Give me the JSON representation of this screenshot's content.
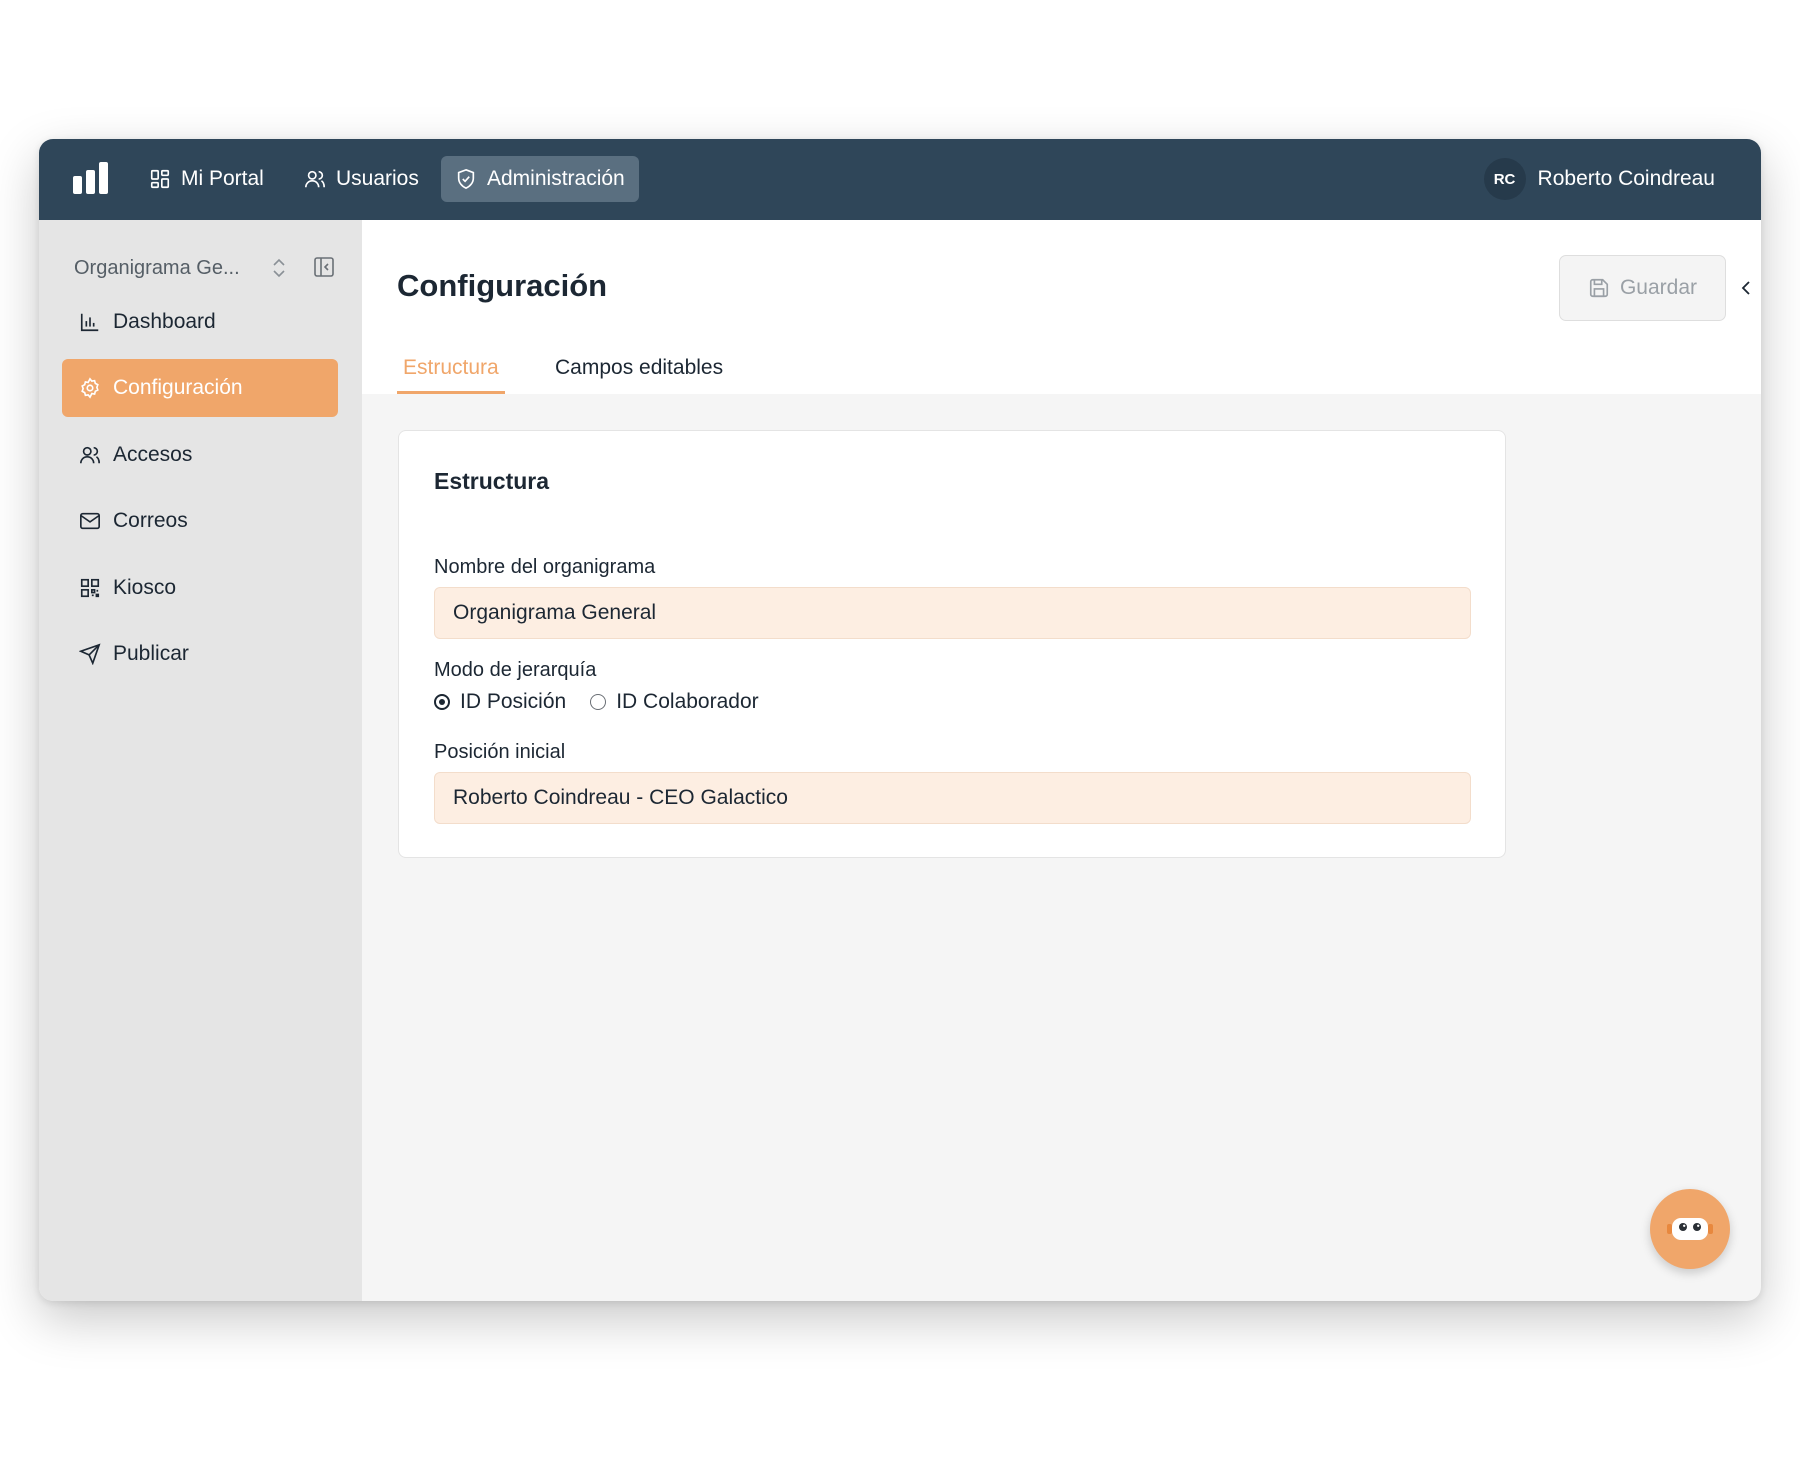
{
  "nav": {
    "items": [
      {
        "label": "Mi Portal",
        "icon": "dashboard-grid-icon"
      },
      {
        "label": "Usuarios",
        "icon": "users-icon"
      },
      {
        "label": "Administración",
        "icon": "shield-icon"
      }
    ],
    "active": "Administración",
    "user": {
      "initials": "RC",
      "name": "Roberto Coindreau"
    }
  },
  "sidebar": {
    "org_selector": "Organigrama Ge...",
    "items": [
      {
        "label": "Dashboard",
        "icon": "bar-chart-icon"
      },
      {
        "label": "Configuración",
        "icon": "gear-icon"
      },
      {
        "label": "Accesos",
        "icon": "users-icon"
      },
      {
        "label": "Correos",
        "icon": "mail-icon"
      },
      {
        "label": "Kiosco",
        "icon": "qr-code-icon"
      },
      {
        "label": "Publicar",
        "icon": "send-icon"
      }
    ],
    "active": "Configuración"
  },
  "main": {
    "title": "Configuración",
    "save_label": "Guardar",
    "tabs": [
      {
        "label": "Estructura",
        "active": true
      },
      {
        "label": "Campos editables",
        "active": false
      }
    ],
    "card": {
      "title": "Estructura",
      "name_label": "Nombre del organigrama",
      "name_value": "Organigrama General",
      "mode_label": "Modo de jerarquía",
      "mode_options": [
        {
          "label": "ID Posición",
          "selected": true
        },
        {
          "label": "ID Colaborador",
          "selected": false
        }
      ],
      "position_label": "Posición inicial",
      "position_value": "Roberto Coindreau - CEO Galactico"
    }
  },
  "colors": {
    "nav_bg": "#2f4659",
    "accent": "#f0a66a",
    "input_bg": "#fdeee2",
    "sidebar_bg": "#e5e5e5"
  }
}
